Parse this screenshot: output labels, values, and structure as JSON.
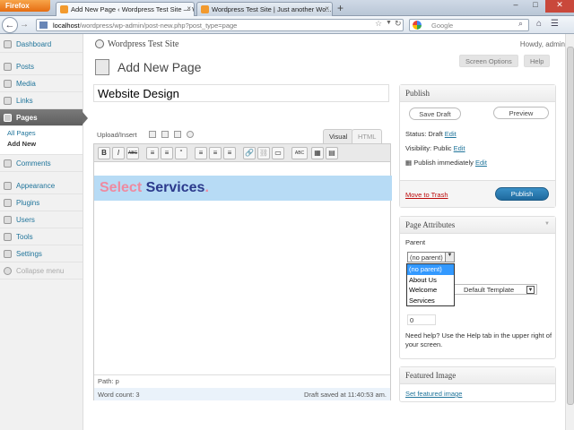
{
  "browser": {
    "app_button": "Firefox",
    "tabs": [
      {
        "label": "Add New Page ‹ Wordpress Test Site — WordPress"
      },
      {
        "label": "Wordpress Test Site | Just another Wo..."
      }
    ],
    "url_host": "localhost",
    "url_path": "/wordpress/wp-admin/post-new.php?post_type=page",
    "search_placeholder": "Google"
  },
  "sidebar": {
    "items": [
      {
        "label": "Dashboard"
      },
      {
        "label": "Posts"
      },
      {
        "label": "Media"
      },
      {
        "label": "Links"
      },
      {
        "label": "Pages"
      },
      {
        "label": "Comments"
      },
      {
        "label": "Appearance"
      },
      {
        "label": "Plugins"
      },
      {
        "label": "Users"
      },
      {
        "label": "Tools"
      },
      {
        "label": "Settings"
      },
      {
        "label": "Collapse menu"
      }
    ],
    "pages_submenu": [
      {
        "label": "All Pages"
      },
      {
        "label": "Add New"
      }
    ]
  },
  "header": {
    "site_name": "Wordpress Test Site",
    "howdy": "Howdy, admin",
    "screen_options": "Screen Options",
    "help": "Help",
    "page_title": "Add New Page"
  },
  "editor": {
    "title_value": "Website Design",
    "upload_insert": "Upload/Insert",
    "tab_visual": "Visual",
    "tab_html": "HTML",
    "toolbar": [
      "B",
      "I",
      "ABC",
      "≡",
      "≡",
      "“",
      "≡",
      "≡",
      "≡",
      "🔗",
      "⛓",
      "▭",
      "ABC",
      "▦",
      "▤"
    ],
    "content_word1": "Select",
    "content_word2": "Services",
    "content_dot": ".",
    "path": "Path: p",
    "word_count": "Word count: 3",
    "draft_saved": "Draft saved at 11:40:53 am."
  },
  "publish": {
    "title": "Publish",
    "save_draft": "Save Draft",
    "preview": "Preview",
    "status_label": "Status: Draft",
    "status_edit": "Edit",
    "visibility_label": "Visibility: Public",
    "visibility_edit": "Edit",
    "schedule_label": "Publish immediately",
    "schedule_edit": "Edit",
    "move_to_trash": "Move to Trash",
    "publish_button": "Publish"
  },
  "attributes": {
    "title": "Page Attributes",
    "parent_label": "Parent",
    "parent_value": "(no parent)",
    "parent_options": [
      "(no parent)",
      "About Us",
      "Welcome",
      "Services"
    ],
    "template_value": "Default Template",
    "order_value": "0",
    "help_text": "Need help? Use the Help tab in the upper right of your screen."
  },
  "featured": {
    "title": "Featured Image",
    "link": "Set featured image"
  }
}
